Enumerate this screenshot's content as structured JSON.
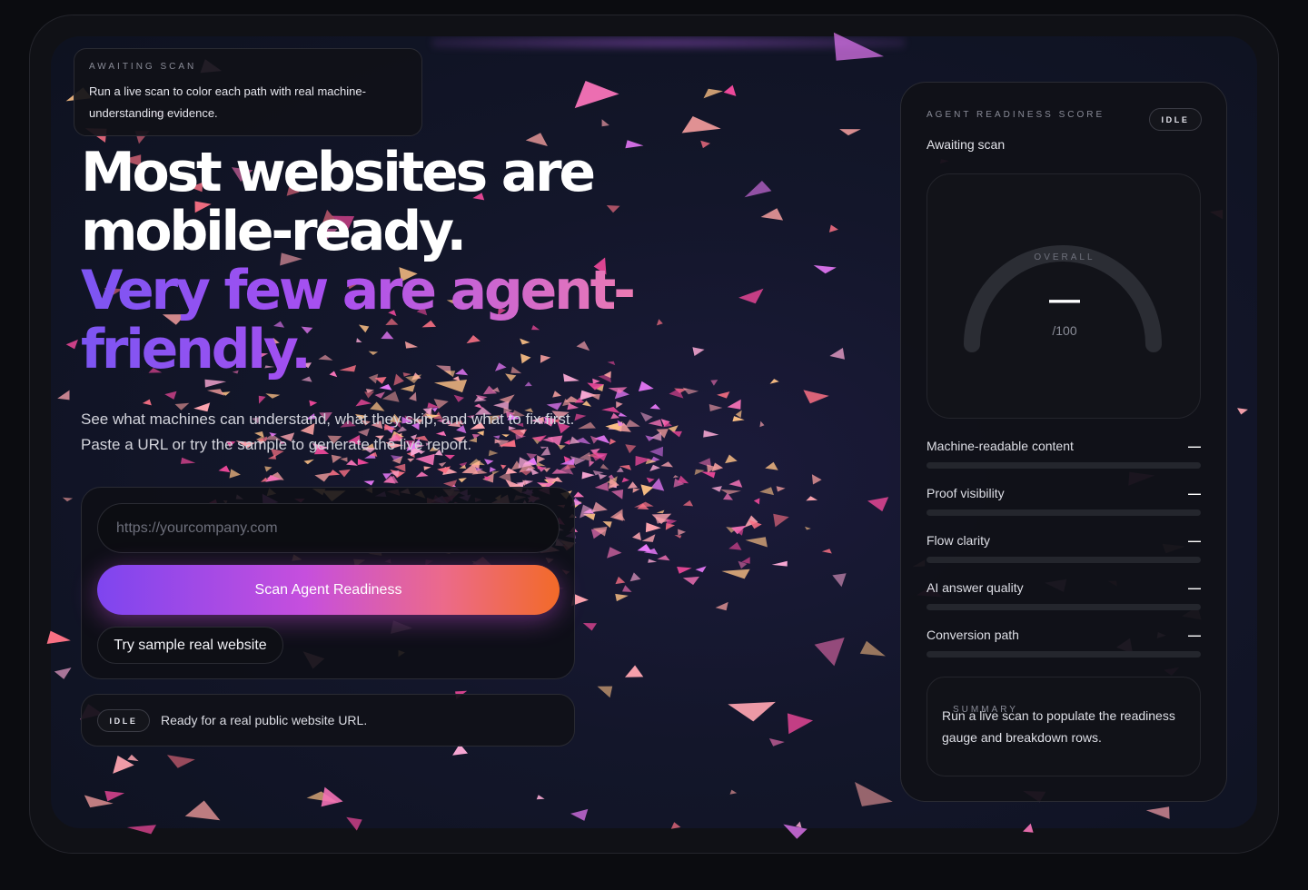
{
  "status_card": {
    "eyebrow": "AWAITING SCAN",
    "message": "Run a live scan to color each path with real machine-understanding evidence."
  },
  "hero": {
    "headline_line1": "Most websites are mobile-ready.",
    "headline_line2": "Very few are agent-friendly.",
    "subhead": "See what machines can understand, what they skip, and what to fix first. Paste a URL or try the sample to generate the live report."
  },
  "scan_form": {
    "url_placeholder": "https://yourcompany.com",
    "url_value": "",
    "scan_button": "Scan Agent Readiness",
    "sample_button": "Try sample real website"
  },
  "status_bar": {
    "badge": "IDLE",
    "message": "Ready for a real public website URL."
  },
  "score_panel": {
    "eyebrow": "AGENT READINESS SCORE",
    "badge": "IDLE",
    "state": "Awaiting scan",
    "gauge": {
      "label": "OVERALL",
      "value": "—",
      "denominator": "/100"
    },
    "metrics": [
      {
        "label": "Machine-readable content",
        "value": "—"
      },
      {
        "label": "Proof visibility",
        "value": "—"
      },
      {
        "label": "Flow clarity",
        "value": "—"
      },
      {
        "label": "AI answer quality",
        "value": "—"
      },
      {
        "label": "Conversion path",
        "value": "—"
      }
    ],
    "summary": {
      "eyebrow": "SUMMARY",
      "text": "Run a live scan to populate the readiness gauge and breakdown rows."
    }
  },
  "colors": {
    "accent_purple": "#7e45ef",
    "accent_pink": "#c64fdd",
    "accent_orange": "#f26a28",
    "background": "#0b0c10"
  }
}
